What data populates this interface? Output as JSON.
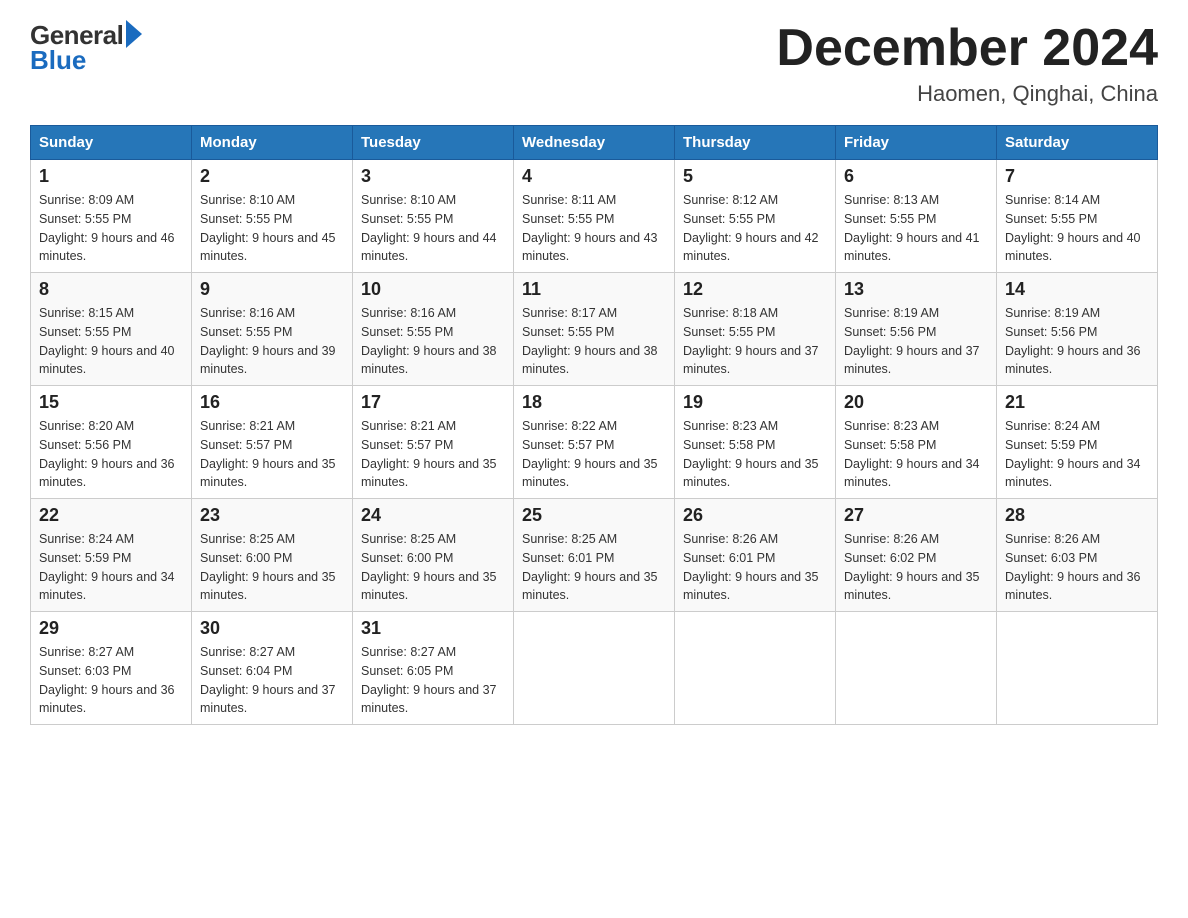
{
  "header": {
    "logo_general": "General",
    "logo_blue": "Blue",
    "month_title": "December 2024",
    "location": "Haomen, Qinghai, China"
  },
  "days_of_week": [
    "Sunday",
    "Monday",
    "Tuesday",
    "Wednesday",
    "Thursday",
    "Friday",
    "Saturday"
  ],
  "weeks": [
    [
      {
        "day": "1",
        "sunrise": "Sunrise: 8:09 AM",
        "sunset": "Sunset: 5:55 PM",
        "daylight": "Daylight: 9 hours and 46 minutes."
      },
      {
        "day": "2",
        "sunrise": "Sunrise: 8:10 AM",
        "sunset": "Sunset: 5:55 PM",
        "daylight": "Daylight: 9 hours and 45 minutes."
      },
      {
        "day": "3",
        "sunrise": "Sunrise: 8:10 AM",
        "sunset": "Sunset: 5:55 PM",
        "daylight": "Daylight: 9 hours and 44 minutes."
      },
      {
        "day": "4",
        "sunrise": "Sunrise: 8:11 AM",
        "sunset": "Sunset: 5:55 PM",
        "daylight": "Daylight: 9 hours and 43 minutes."
      },
      {
        "day": "5",
        "sunrise": "Sunrise: 8:12 AM",
        "sunset": "Sunset: 5:55 PM",
        "daylight": "Daylight: 9 hours and 42 minutes."
      },
      {
        "day": "6",
        "sunrise": "Sunrise: 8:13 AM",
        "sunset": "Sunset: 5:55 PM",
        "daylight": "Daylight: 9 hours and 41 minutes."
      },
      {
        "day": "7",
        "sunrise": "Sunrise: 8:14 AM",
        "sunset": "Sunset: 5:55 PM",
        "daylight": "Daylight: 9 hours and 40 minutes."
      }
    ],
    [
      {
        "day": "8",
        "sunrise": "Sunrise: 8:15 AM",
        "sunset": "Sunset: 5:55 PM",
        "daylight": "Daylight: 9 hours and 40 minutes."
      },
      {
        "day": "9",
        "sunrise": "Sunrise: 8:16 AM",
        "sunset": "Sunset: 5:55 PM",
        "daylight": "Daylight: 9 hours and 39 minutes."
      },
      {
        "day": "10",
        "sunrise": "Sunrise: 8:16 AM",
        "sunset": "Sunset: 5:55 PM",
        "daylight": "Daylight: 9 hours and 38 minutes."
      },
      {
        "day": "11",
        "sunrise": "Sunrise: 8:17 AM",
        "sunset": "Sunset: 5:55 PM",
        "daylight": "Daylight: 9 hours and 38 minutes."
      },
      {
        "day": "12",
        "sunrise": "Sunrise: 8:18 AM",
        "sunset": "Sunset: 5:55 PM",
        "daylight": "Daylight: 9 hours and 37 minutes."
      },
      {
        "day": "13",
        "sunrise": "Sunrise: 8:19 AM",
        "sunset": "Sunset: 5:56 PM",
        "daylight": "Daylight: 9 hours and 37 minutes."
      },
      {
        "day": "14",
        "sunrise": "Sunrise: 8:19 AM",
        "sunset": "Sunset: 5:56 PM",
        "daylight": "Daylight: 9 hours and 36 minutes."
      }
    ],
    [
      {
        "day": "15",
        "sunrise": "Sunrise: 8:20 AM",
        "sunset": "Sunset: 5:56 PM",
        "daylight": "Daylight: 9 hours and 36 minutes."
      },
      {
        "day": "16",
        "sunrise": "Sunrise: 8:21 AM",
        "sunset": "Sunset: 5:57 PM",
        "daylight": "Daylight: 9 hours and 35 minutes."
      },
      {
        "day": "17",
        "sunrise": "Sunrise: 8:21 AM",
        "sunset": "Sunset: 5:57 PM",
        "daylight": "Daylight: 9 hours and 35 minutes."
      },
      {
        "day": "18",
        "sunrise": "Sunrise: 8:22 AM",
        "sunset": "Sunset: 5:57 PM",
        "daylight": "Daylight: 9 hours and 35 minutes."
      },
      {
        "day": "19",
        "sunrise": "Sunrise: 8:23 AM",
        "sunset": "Sunset: 5:58 PM",
        "daylight": "Daylight: 9 hours and 35 minutes."
      },
      {
        "day": "20",
        "sunrise": "Sunrise: 8:23 AM",
        "sunset": "Sunset: 5:58 PM",
        "daylight": "Daylight: 9 hours and 34 minutes."
      },
      {
        "day": "21",
        "sunrise": "Sunrise: 8:24 AM",
        "sunset": "Sunset: 5:59 PM",
        "daylight": "Daylight: 9 hours and 34 minutes."
      }
    ],
    [
      {
        "day": "22",
        "sunrise": "Sunrise: 8:24 AM",
        "sunset": "Sunset: 5:59 PM",
        "daylight": "Daylight: 9 hours and 34 minutes."
      },
      {
        "day": "23",
        "sunrise": "Sunrise: 8:25 AM",
        "sunset": "Sunset: 6:00 PM",
        "daylight": "Daylight: 9 hours and 35 minutes."
      },
      {
        "day": "24",
        "sunrise": "Sunrise: 8:25 AM",
        "sunset": "Sunset: 6:00 PM",
        "daylight": "Daylight: 9 hours and 35 minutes."
      },
      {
        "day": "25",
        "sunrise": "Sunrise: 8:25 AM",
        "sunset": "Sunset: 6:01 PM",
        "daylight": "Daylight: 9 hours and 35 minutes."
      },
      {
        "day": "26",
        "sunrise": "Sunrise: 8:26 AM",
        "sunset": "Sunset: 6:01 PM",
        "daylight": "Daylight: 9 hours and 35 minutes."
      },
      {
        "day": "27",
        "sunrise": "Sunrise: 8:26 AM",
        "sunset": "Sunset: 6:02 PM",
        "daylight": "Daylight: 9 hours and 35 minutes."
      },
      {
        "day": "28",
        "sunrise": "Sunrise: 8:26 AM",
        "sunset": "Sunset: 6:03 PM",
        "daylight": "Daylight: 9 hours and 36 minutes."
      }
    ],
    [
      {
        "day": "29",
        "sunrise": "Sunrise: 8:27 AM",
        "sunset": "Sunset: 6:03 PM",
        "daylight": "Daylight: 9 hours and 36 minutes."
      },
      {
        "day": "30",
        "sunrise": "Sunrise: 8:27 AM",
        "sunset": "Sunset: 6:04 PM",
        "daylight": "Daylight: 9 hours and 37 minutes."
      },
      {
        "day": "31",
        "sunrise": "Sunrise: 8:27 AM",
        "sunset": "Sunset: 6:05 PM",
        "daylight": "Daylight: 9 hours and 37 minutes."
      },
      null,
      null,
      null,
      null
    ]
  ]
}
